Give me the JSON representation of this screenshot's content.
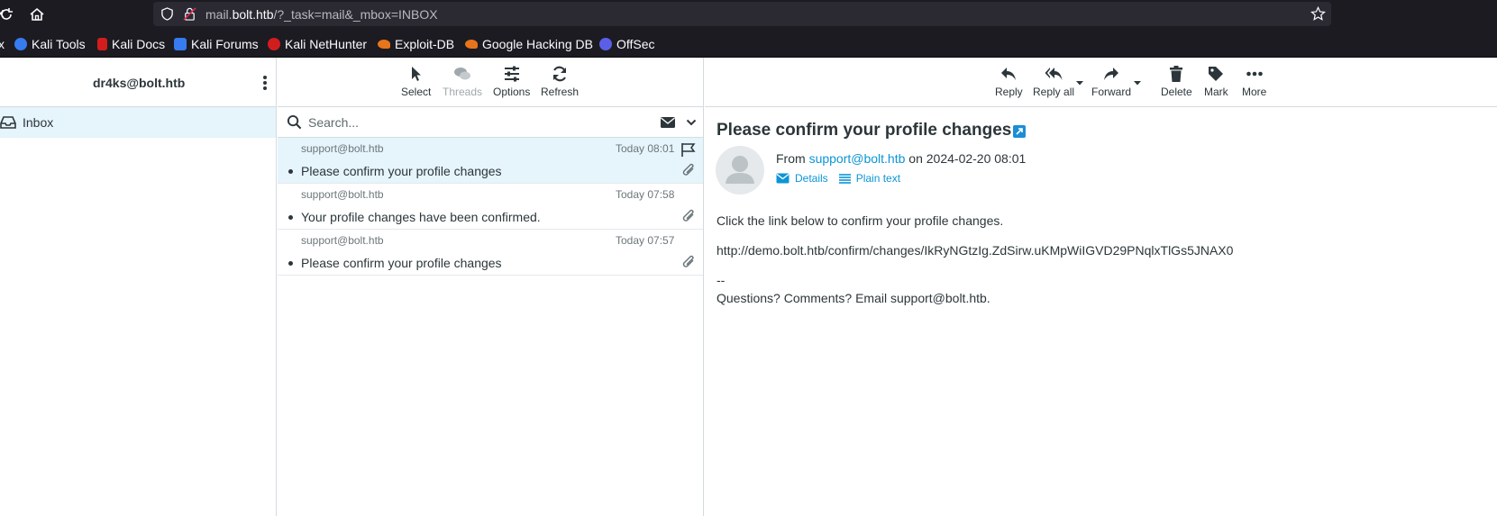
{
  "browser": {
    "url_prefix": "mail.",
    "url_domain": "bolt.htb",
    "url_path": "/?_task=mail&_mbox=INBOX",
    "left_edge_glyph": "x",
    "bookmarks": [
      {
        "label": "Kali Tools",
        "color": "#367bf0"
      },
      {
        "label": "Kali Docs",
        "color": "#d21d1d"
      },
      {
        "label": "Kali Forums",
        "color": "#367bf0"
      },
      {
        "label": "Kali NetHunter",
        "color": "#d21d1d"
      },
      {
        "label": "Exploit-DB",
        "color": "#e8741c"
      },
      {
        "label": "Google Hacking DB",
        "color": "#e8741c"
      },
      {
        "label": "OffSec",
        "color": "#5b5fe8"
      }
    ]
  },
  "account": "dr4ks@bolt.htb",
  "folders": [
    {
      "label": "Inbox"
    }
  ],
  "list_toolbar": {
    "select": "Select",
    "threads": "Threads",
    "options": "Options",
    "refresh": "Refresh"
  },
  "search": {
    "placeholder": "Search..."
  },
  "messages": [
    {
      "from": "support@bolt.htb",
      "date": "Today 08:01",
      "subject": "Please confirm your profile changes",
      "selected": true
    },
    {
      "from": "support@bolt.htb",
      "date": "Today 07:58",
      "subject": "Your profile changes have been confirmed.",
      "selected": false
    },
    {
      "from": "support@bolt.htb",
      "date": "Today 07:57",
      "subject": "Please confirm your profile changes",
      "selected": false
    }
  ],
  "view_toolbar": {
    "reply": "Reply",
    "reply_all": "Reply all",
    "forward": "Forward",
    "delete": "Delete",
    "mark": "Mark",
    "more": "More"
  },
  "message_view": {
    "subject": "Please confirm your profile changes",
    "from_label": "From",
    "from_address": "support@bolt.htb",
    "date_text": "on 2024-02-20 08:01",
    "details_label": "Details",
    "plain_text_label": "Plain text",
    "body_line1": "Click the link below to confirm your profile changes.",
    "body_link": "http://demo.bolt.htb/confirm/changes/IkRyNGtzIg.ZdSirw.uKMpWiIGVD29PNqlxTlGs5JNAX0",
    "body_sig_sep": "--",
    "body_sig": "Questions? Comments? Email support@bolt.htb."
  },
  "colors": {
    "accent": "#0c95d6",
    "selected_row": "#e6f4fb"
  }
}
